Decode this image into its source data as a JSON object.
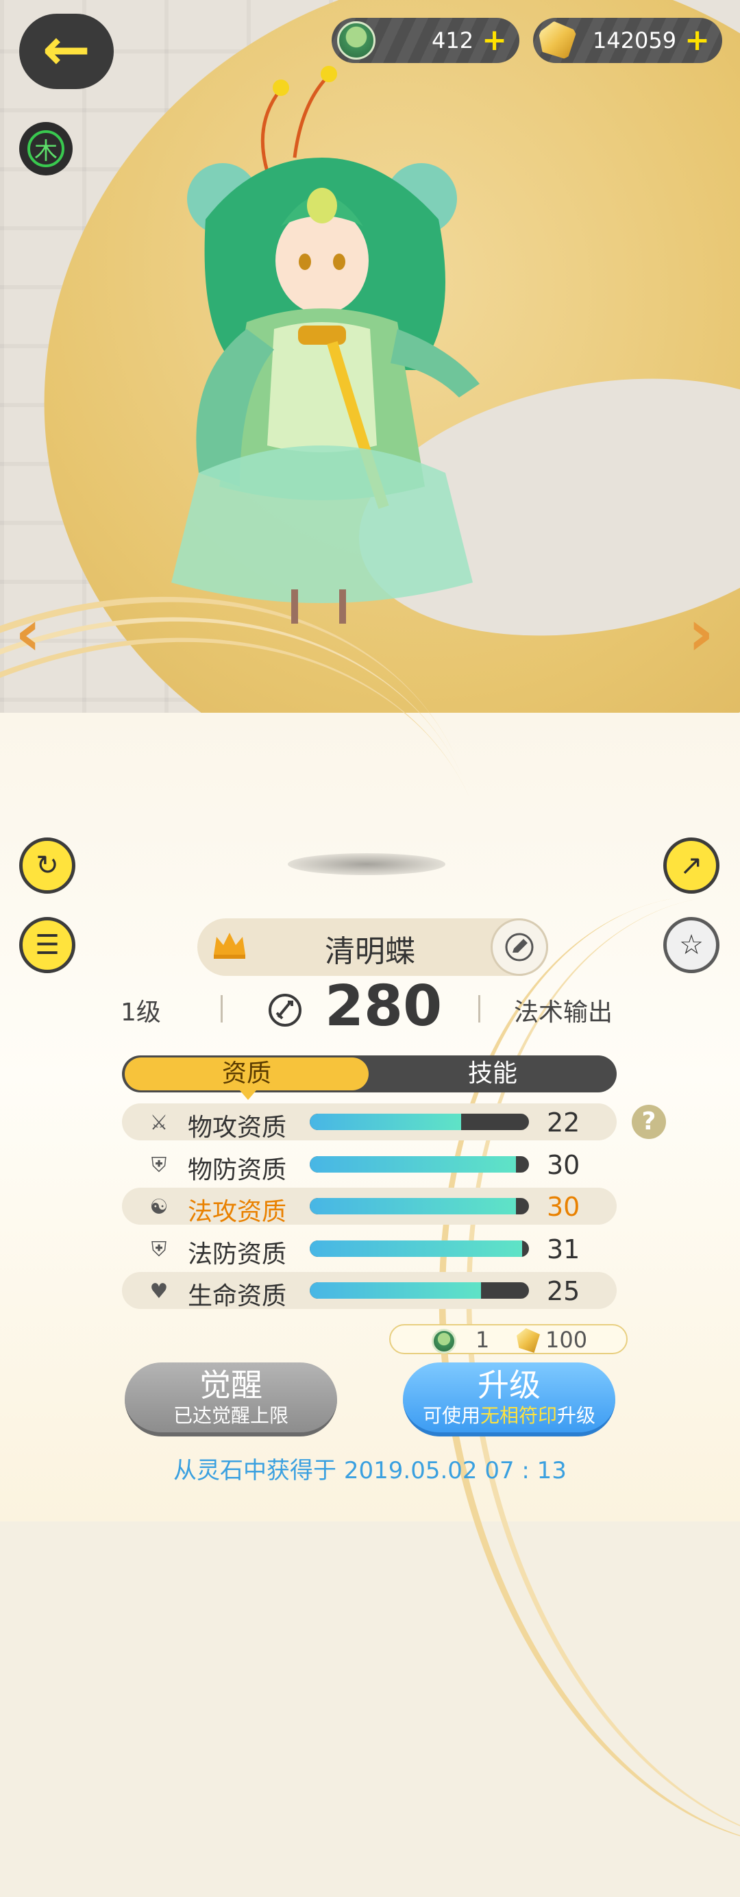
{
  "header": {
    "back_icon": "back-arrow-icon",
    "element": "木",
    "resources": [
      {
        "icon": "spirit-avatar-icon",
        "value": "412",
        "plus": "+"
      },
      {
        "icon": "crystal-icon",
        "value": "142059",
        "plus": "+"
      }
    ]
  },
  "nav": {
    "prev": "‹",
    "next": "›"
  },
  "pet": {
    "name": "清明蝶",
    "level": "1级",
    "power": "280",
    "role": "法术输出"
  },
  "tabs": {
    "aptitude": "资质",
    "skills": "技能"
  },
  "aptitudes": [
    {
      "icon": "crossed-swords-icon",
      "label": "物攻资质",
      "value": "22",
      "fill": 0.69
    },
    {
      "icon": "shield-icon",
      "label": "物防资质",
      "value": "30",
      "fill": 0.94
    },
    {
      "icon": "swirl-icon",
      "label": "法攻资质",
      "value": "30",
      "fill": 0.94,
      "highlighted": true
    },
    {
      "icon": "shield-icon",
      "label": "法防资质",
      "value": "31",
      "fill": 0.97
    },
    {
      "icon": "heart-icon",
      "label": "生命资质",
      "value": "25",
      "fill": 0.78
    }
  ],
  "help": "?",
  "cost": {
    "spirit_count": "1",
    "crystal_count": "100"
  },
  "buttons": {
    "awaken": {
      "title": "觉醒",
      "subtitle": "已达觉醒上限"
    },
    "upgrade": {
      "title": "升级",
      "subtitle_pre": "可使用",
      "subtitle_highlight": "无相符印",
      "subtitle_post": "升级"
    }
  },
  "source": "从灵石中获得于 2019.05.02   07 : 13",
  "colors": {
    "accent": "#f7c33b",
    "highlight": "#e98100",
    "upgrade": "#3d9cf2",
    "link": "#3aa0e0"
  }
}
